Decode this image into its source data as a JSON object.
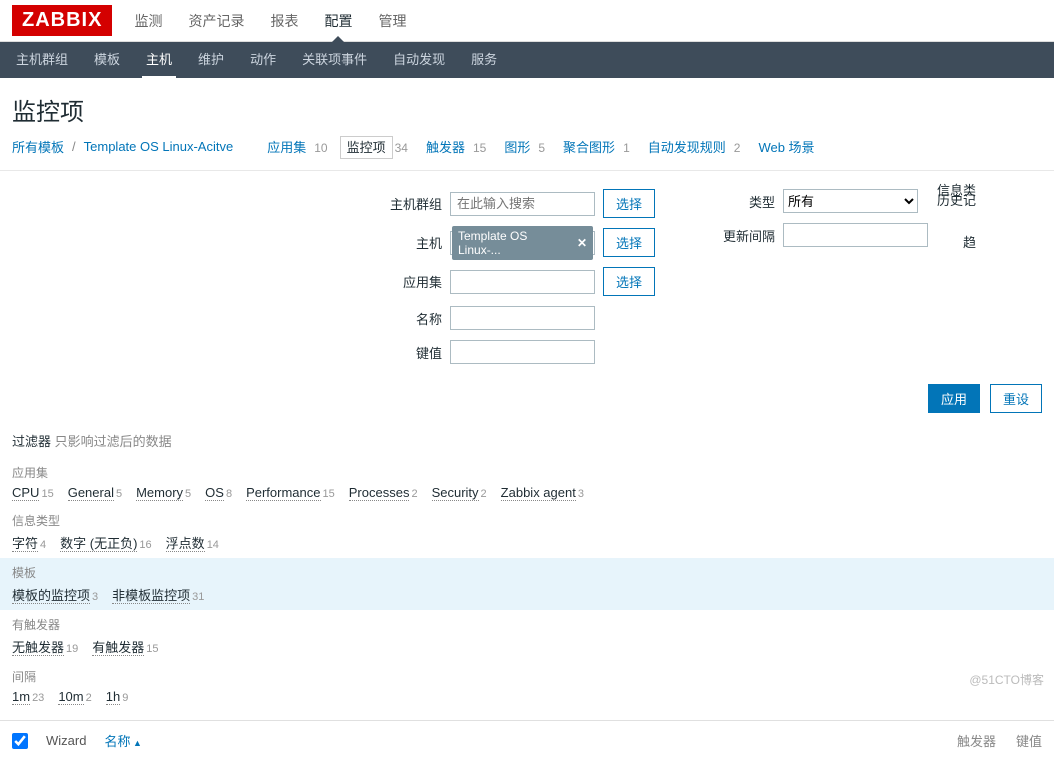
{
  "logo": "ZABBIX",
  "mainNav": {
    "items": [
      "监测",
      "资产记录",
      "报表",
      "配置",
      "管理"
    ],
    "active": 3
  },
  "subNav": {
    "items": [
      "主机群组",
      "模板",
      "主机",
      "维护",
      "动作",
      "关联项事件",
      "自动发现",
      "服务"
    ],
    "active": 2
  },
  "pageTitle": "监控项",
  "breadcrumb": {
    "root": "所有模板",
    "template": "Template OS Linux-Acitve",
    "tabs": [
      {
        "label": "应用集",
        "count": "10"
      },
      {
        "label": "监控项",
        "count": "34",
        "active": true
      },
      {
        "label": "触发器",
        "count": "15"
      },
      {
        "label": "图形",
        "count": "5"
      },
      {
        "label": "聚合图形",
        "count": "1"
      },
      {
        "label": "自动发现规则",
        "count": "2"
      },
      {
        "label": "Web 场景",
        "count": ""
      }
    ]
  },
  "filter": {
    "hostGroup": {
      "label": "主机群组",
      "placeholder": "在此输入搜索",
      "select": "选择"
    },
    "host": {
      "label": "主机",
      "chip": "Template OS Linux-...",
      "select": "选择"
    },
    "appSet": {
      "label": "应用集",
      "select": "选择"
    },
    "name": {
      "label": "名称"
    },
    "key": {
      "label": "键值"
    },
    "type": {
      "label": "类型",
      "value": "所有"
    },
    "updateInterval": {
      "label": "更新间隔"
    },
    "infoType": {
      "label": "信息类"
    },
    "history": {
      "label": "历史记"
    },
    "trend": {
      "label": "趋"
    }
  },
  "actions": {
    "apply": "应用",
    "reset": "重设"
  },
  "subfilter": {
    "title": "过滤器",
    "hint": "只影响过滤后的数据",
    "groups": [
      {
        "label": "应用集",
        "items": [
          {
            "n": "CPU",
            "c": "15"
          },
          {
            "n": "General",
            "c": "5"
          },
          {
            "n": "Memory",
            "c": "5"
          },
          {
            "n": "OS",
            "c": "8"
          },
          {
            "n": "Performance",
            "c": "15"
          },
          {
            "n": "Processes",
            "c": "2"
          },
          {
            "n": "Security",
            "c": "2"
          },
          {
            "n": "Zabbix agent",
            "c": "3"
          }
        ]
      },
      {
        "label": "信息类型",
        "items": [
          {
            "n": "字符",
            "c": "4"
          },
          {
            "n": "数字 (无正负)",
            "c": "16"
          },
          {
            "n": "浮点数",
            "c": "14"
          }
        ]
      },
      {
        "label": "模板",
        "hl": true,
        "items": [
          {
            "n": "模板的监控项",
            "c": "3"
          },
          {
            "n": "非模板监控项",
            "c": "31"
          }
        ]
      },
      {
        "label": "有触发器",
        "items": [
          {
            "n": "无触发器",
            "c": "19"
          },
          {
            "n": "有触发器",
            "c": "15"
          }
        ]
      },
      {
        "label": "间隔",
        "items": [
          {
            "n": "1m",
            "c": "23"
          },
          {
            "n": "10m",
            "c": "2"
          },
          {
            "n": "1h",
            "c": "9"
          }
        ]
      }
    ]
  },
  "table": {
    "wizard": "Wizard",
    "name": "名称",
    "right": [
      "触发器",
      "键值"
    ]
  },
  "watermark": "@51CTO博客"
}
